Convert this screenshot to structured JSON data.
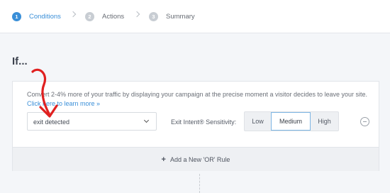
{
  "steps": [
    {
      "number": "1",
      "label": "Conditions",
      "active": true
    },
    {
      "number": "2",
      "label": "Actions",
      "active": false
    },
    {
      "number": "3",
      "label": "Summary",
      "active": false
    }
  ],
  "heading": "If...",
  "rule": {
    "description": "Convert 2-4% more of your traffic by displaying your campaign at the precise moment a visitor decides to leave your site.",
    "link_text": "Click here to learn more »",
    "condition_value": "exit detected",
    "sensitivity_label": "Exit Intent® Sensitivity:",
    "sensitivity_options": [
      "Low",
      "Medium",
      "High"
    ],
    "sensitivity_selected": "Medium"
  },
  "add_rule_label": "Add a New 'OR' Rule",
  "colors": {
    "accent": "#3a8fd8",
    "annotation_arrow": "#e02020"
  }
}
